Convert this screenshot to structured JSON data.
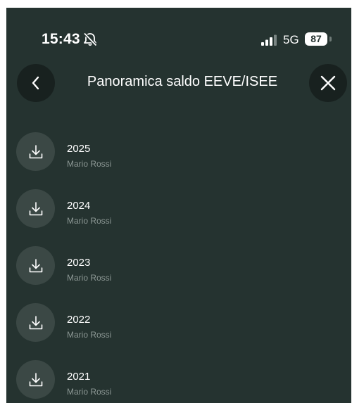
{
  "status_bar": {
    "time": "15:43",
    "network": "5G",
    "battery": "87",
    "icons": [
      "bell-muted-icon",
      "signal-icon"
    ]
  },
  "header": {
    "title": "Panoramica saldo EEVE/ISEE",
    "back_icon": "chevron-left-icon",
    "close_icon": "close-icon"
  },
  "list": {
    "icon": "download-icon",
    "items": [
      {
        "year": "2025",
        "name": "Mario Rossi"
      },
      {
        "year": "2024",
        "name": "Mario Rossi"
      },
      {
        "year": "2023",
        "name": "Mario Rossi"
      },
      {
        "year": "2022",
        "name": "Mario Rossi"
      },
      {
        "year": "2021",
        "name": "Mario Rossi"
      }
    ]
  },
  "colors": {
    "background": "#253330",
    "header_button": "#18211f",
    "download_circle": "#3b4845",
    "secondary_text": "#8c9794"
  }
}
